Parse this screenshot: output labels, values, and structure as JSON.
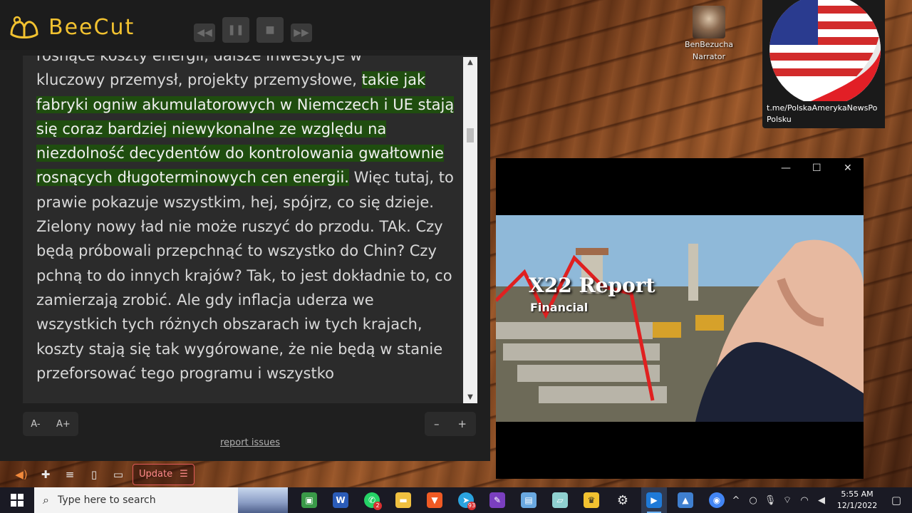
{
  "app": {
    "name": "BeeCut",
    "brand_color": "#f2c230"
  },
  "reader": {
    "text_before_highlight_partial": "rosnące koszty energii, dalsze inwestycje w",
    "text_before_highlight": "kluczowy przemysł, projekty przemysłowe, ",
    "text_highlight": "takie jak fabryki ogniw akumulatorowych w Niemczech i UE stają się coraz bardziej niewykonalne ze względu na niezdolność decydentów do kontrolowania gwałtownie rosnących długoterminowych cen energii.",
    "text_after_highlight": " Więc tutaj, to prawie pokazuje wszystkim, hej, spójrz, co się dzieje. Zielony nowy ład nie może ruszyć do przodu. TAk. Czy będą próbowali przepchnąć to wszystko do Chin? Czy pchną to do innych krajów? Tak, to jest dokładnie to, co zamierzają zrobić. Ale gdy inflacja uderza we wszystkich tych różnych obszarach iw tych krajach, koszty stają się tak wygórowane, że nie będą w stanie przeforsować tego programu i wszystko",
    "highlight_color": "#1f4d0f",
    "font_decrease_label": "A-",
    "font_increase_label": "A+",
    "zoom_out_label": "–",
    "zoom_in_label": "+",
    "report_issues_label": "report issues"
  },
  "toolbar": {
    "update_label": "Update"
  },
  "overlay": {
    "narrator_name": "BenBezucha",
    "narrator_role": "Narrator",
    "channel_link_line1": "t.me/PolskaAmerykaNewsPo",
    "channel_link_line2": "Polsku"
  },
  "video": {
    "title": "X22 Report",
    "subtitle": "Financial"
  },
  "taskbar": {
    "search_placeholder": "Type here to search",
    "time": "5:55 AM",
    "date": "12/1/2022",
    "telegram_badge": "93",
    "whatsapp_badge": "2"
  }
}
